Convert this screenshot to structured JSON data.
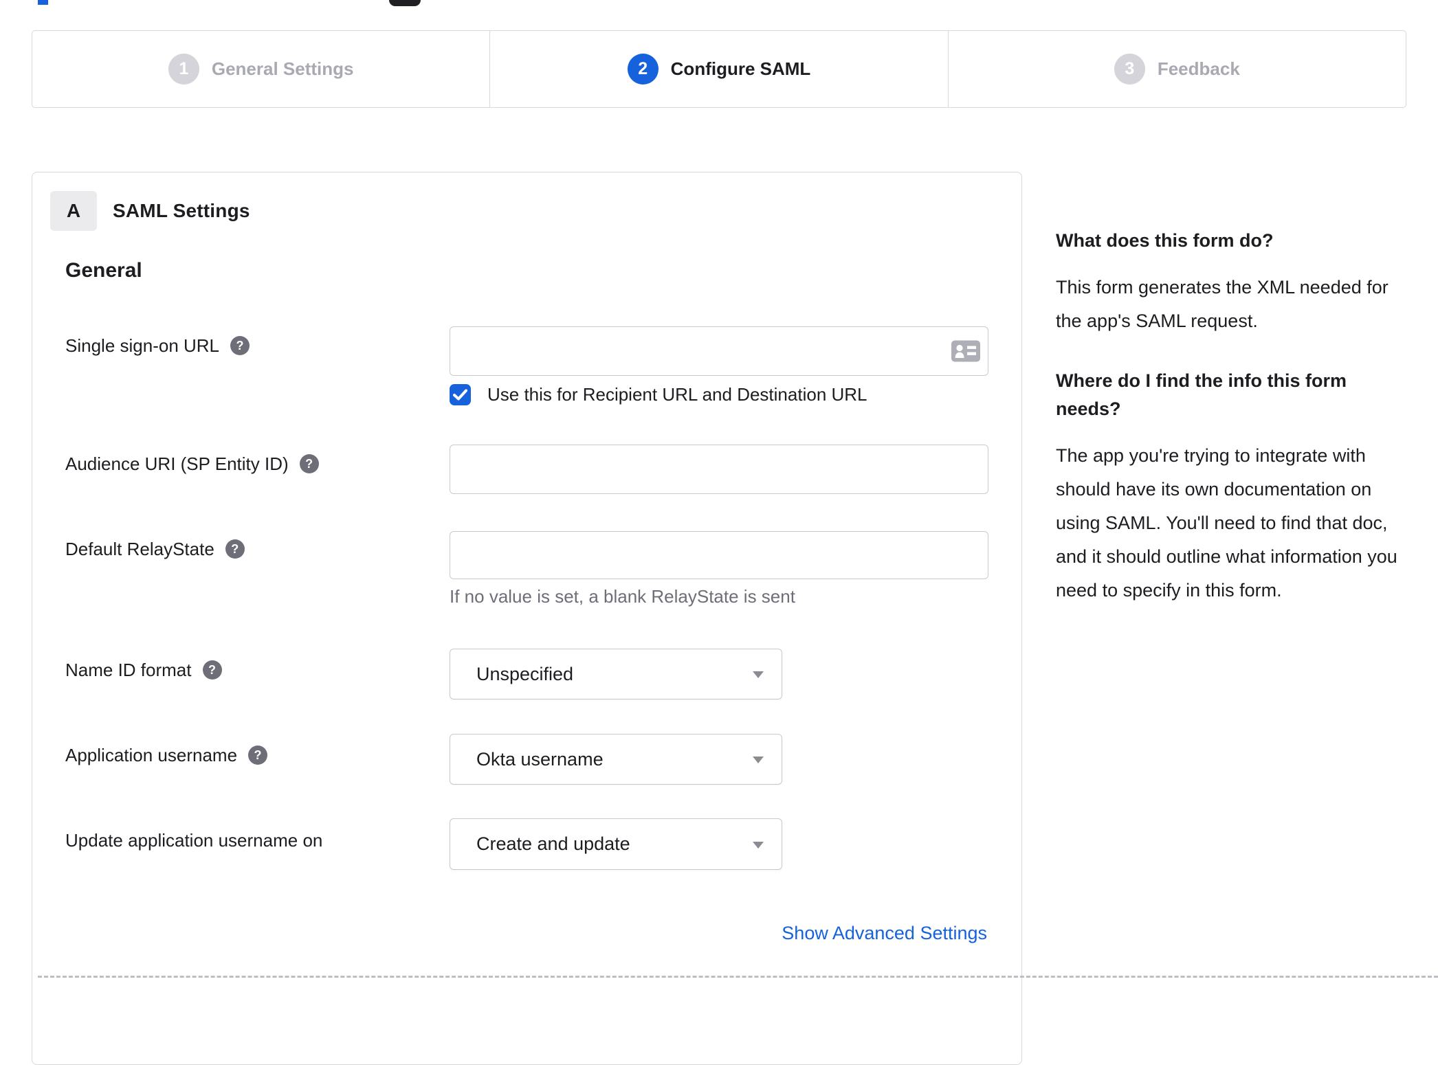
{
  "page": {
    "stepper": {
      "steps": [
        {
          "number": "1",
          "label": "General Settings",
          "state": "inactive"
        },
        {
          "number": "2",
          "label": "Configure SAML",
          "state": "active"
        },
        {
          "number": "3",
          "label": "Feedback",
          "state": "inactive"
        }
      ]
    },
    "panel": {
      "section_badge": "A",
      "section_title": "SAML Settings",
      "group_heading": "General",
      "fields": {
        "sso": {
          "label": "Single sign-on URL",
          "value": "",
          "checkbox_label": "Use this for Recipient URL and Destination URL",
          "checkbox_checked": true
        },
        "audience": {
          "label": "Audience URI (SP Entity ID)",
          "value": ""
        },
        "relay": {
          "label": "Default RelayState",
          "value": "",
          "hint": "If no value is set, a blank RelayState is sent"
        },
        "nameid": {
          "label": "Name ID format",
          "value": "Unspecified"
        },
        "appuser": {
          "label": "Application username",
          "value": "Okta username"
        },
        "update": {
          "label": "Update application username on",
          "value": "Create and update"
        }
      },
      "advanced_link": "Show Advanced Settings"
    },
    "help_panel": {
      "q1": "What does this form do?",
      "a1": "This form generates the XML needed for the app's SAML request.",
      "q2": "Where do I find the info this form needs?",
      "a2": "The app you're trying to integrate with should have its own documentation on using SAML. You'll need to find that doc, and it should outline what information you need to specify in this form."
    },
    "icons": {
      "sso_field_icon": "contact-card-icon",
      "field_help_icon": "question-mark-icon",
      "select_icon": "caret-down-icon",
      "checkbox_icon": "checkmark-icon"
    },
    "colors": {
      "accent_blue": "#1662dd",
      "text_dark": "#1d1d21",
      "help_icon_gray": "#6e6e78",
      "inactive_gray": "#a9a9b2",
      "border_gray": "#d7d7dd"
    }
  }
}
